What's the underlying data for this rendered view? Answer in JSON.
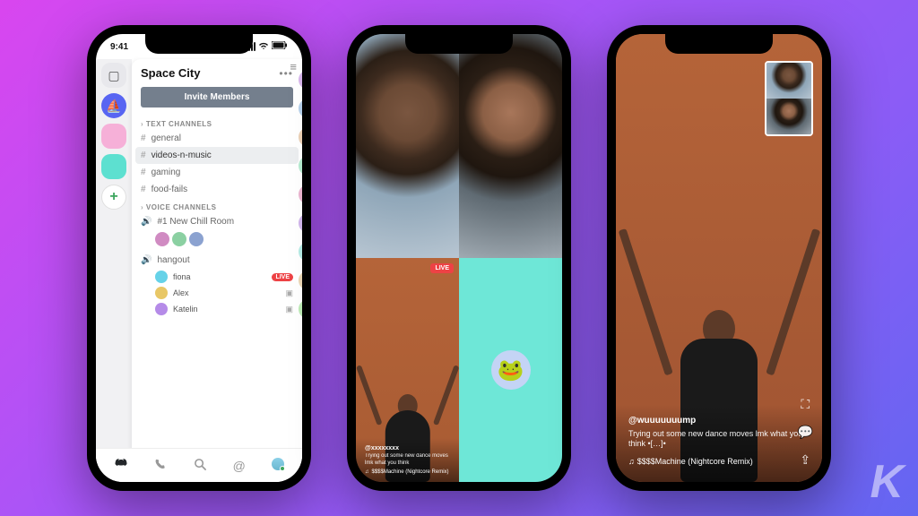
{
  "status": {
    "time": "9:41"
  },
  "server": {
    "name": "Space City",
    "invite_label": "Invite Members",
    "text_section": "TEXT CHANNELS",
    "voice_section": "VOICE CHANNELS",
    "text_channels": [
      "general",
      "videos-n-music",
      "gaming",
      "food-fails"
    ],
    "selected_text_channel": "videos-n-music",
    "voice_channels": {
      "chill": {
        "name": "#1 New Chill Room"
      },
      "hangout": {
        "name": "hangout",
        "users": [
          {
            "name": "fiona",
            "live": true
          },
          {
            "name": "Alex",
            "live": false
          },
          {
            "name": "Katelin",
            "live": false
          }
        ]
      }
    }
  },
  "call_grid": {
    "live_label": "LIVE",
    "handle": "@xxxxxxxx",
    "caption": "Trying out some new dance moves lmk what you think",
    "track": "$$$$Machine (Nightcore Remix)"
  },
  "stream": {
    "handle": "@wuuuuuuump",
    "caption": "Trying out some new dance moves lmk what you think •[…]•",
    "track": "$$$$Machine (Nightcore Remix)"
  },
  "watermark": "K"
}
